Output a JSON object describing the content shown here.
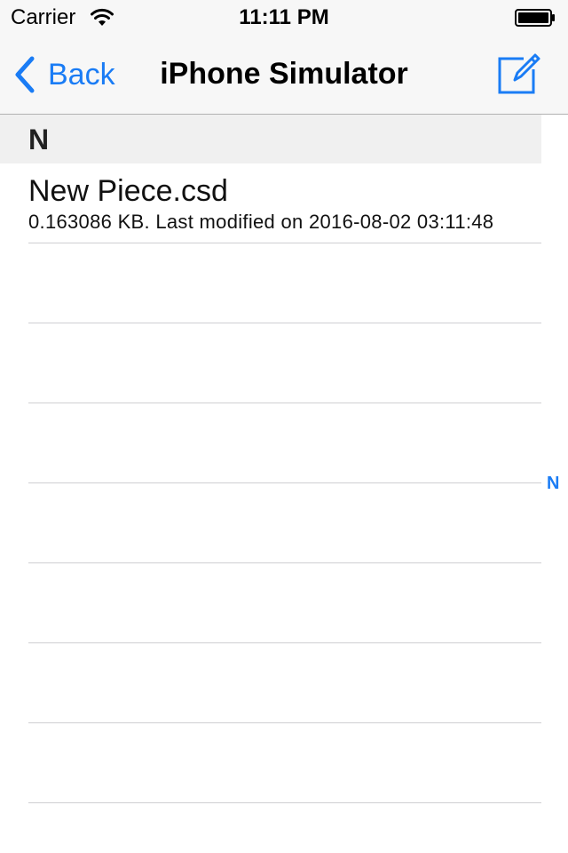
{
  "status_bar": {
    "carrier": "Carrier",
    "time": "11:11 PM",
    "wifi_icon": "wifi-icon",
    "battery_icon": "battery-icon"
  },
  "nav": {
    "back_label": "Back",
    "title": "iPhone Simulator",
    "compose_icon": "compose-icon",
    "accent_color": "#1a7cf5"
  },
  "section": {
    "title": "N"
  },
  "files": [
    {
      "name": "New Piece.csd",
      "detail": "0.163086 KB. Last modified on 2016-08-02 03:11:48"
    }
  ],
  "index": {
    "letters": [
      "N"
    ]
  }
}
